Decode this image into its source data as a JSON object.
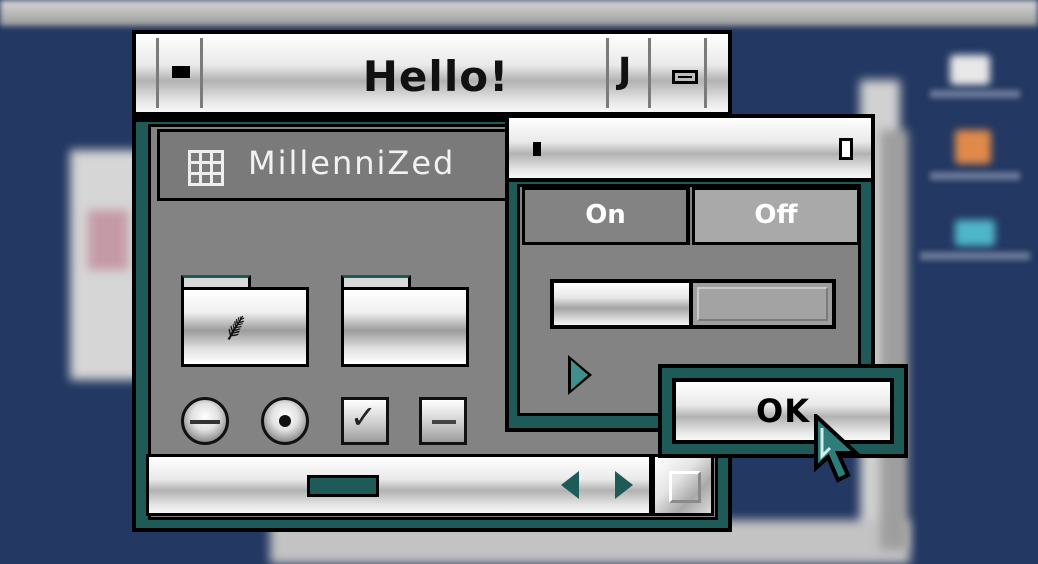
{
  "window": {
    "title": "Hello!",
    "zoom_glyph": "J",
    "header_label": "MillenniZed"
  },
  "palette": {
    "segment_on": "On",
    "segment_off": "Off",
    "progress": 0.5
  },
  "dialog": {
    "ok_label": "OK"
  },
  "icons": {
    "folder_1": "app-folder-icon",
    "folder_2": "empty-folder-icon",
    "header": "grid-icon"
  },
  "colors": {
    "accent": "#1d5a58",
    "desktop": "#233862",
    "panel": "#838383"
  }
}
